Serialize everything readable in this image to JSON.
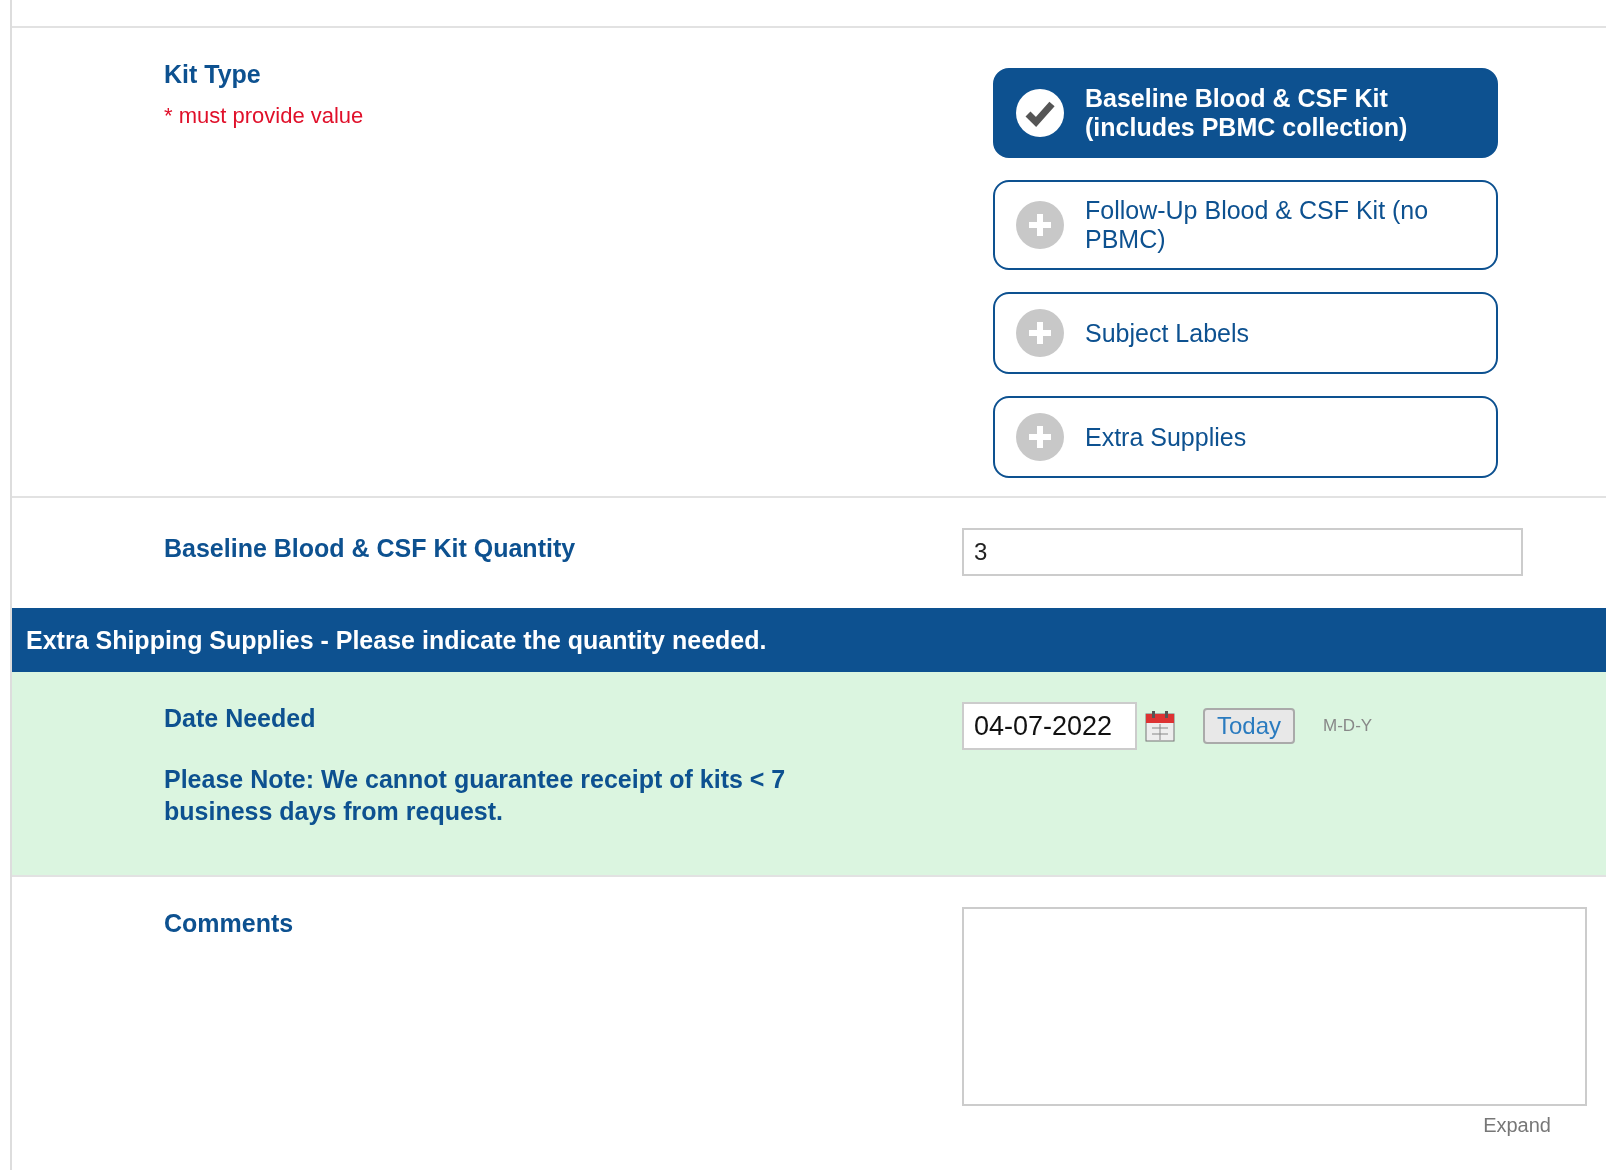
{
  "kit_type": {
    "label": "Kit Type",
    "required_note": "* must provide value",
    "options": [
      {
        "label": "Baseline Blood & CSF Kit (includes PBMC collection)",
        "selected": true
      },
      {
        "label": "Follow-Up Blood & CSF Kit (no PBMC)",
        "selected": false
      },
      {
        "label": "Subject Labels",
        "selected": false
      },
      {
        "label": "Extra Supplies",
        "selected": false
      }
    ]
  },
  "quantity": {
    "label": "Baseline Blood & CSF Kit Quantity",
    "value": "3"
  },
  "section_header": "Extra Shipping Supplies - Please indicate the quantity needed.",
  "date_needed": {
    "label": "Date Needed",
    "value": "04-07-2022",
    "today_button": "Today",
    "format": "M-D-Y",
    "note": "Please Note: We cannot guarantee receipt of kits < 7 business days from request."
  },
  "comments": {
    "label": "Comments",
    "expand_link": "Expand"
  }
}
